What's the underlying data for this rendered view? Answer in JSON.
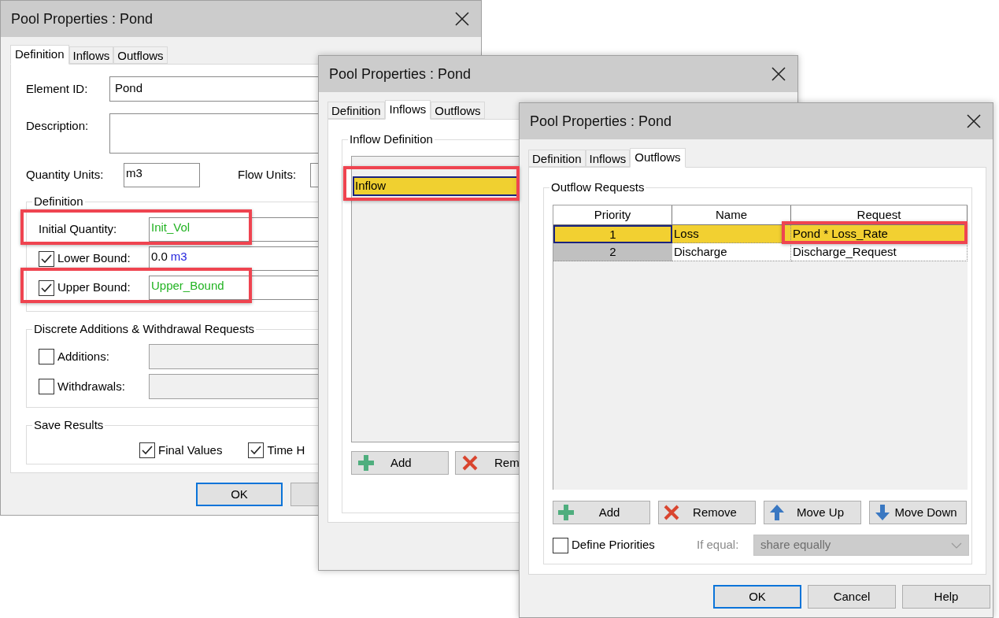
{
  "definition_dialog": {
    "title": "Pool Properties : Pond",
    "tabs": [
      {
        "label": "Definition",
        "selected": true
      },
      {
        "label": "Inflows",
        "selected": false
      },
      {
        "label": "Outflows",
        "selected": false
      }
    ],
    "element_id": {
      "label": "Element ID:",
      "value": "Pond"
    },
    "description": {
      "label": "Description:"
    },
    "quantity_units": {
      "label": "Quantity Units:",
      "value": "m3"
    },
    "flow_units": {
      "label": "Flow Units:"
    },
    "definition": {
      "title": "Definition",
      "initial_quantity": {
        "label": "Initial Quantity:",
        "kind": "expression",
        "value": "Init_Vol",
        "highlighted": true
      },
      "bounds": [
        {
          "label": "Lower Bound:",
          "checked": true,
          "kind": "number",
          "value": "0.0",
          "unit": "m3",
          "highlighted": false
        },
        {
          "label": "Upper Bound:",
          "checked": true,
          "kind": "expression",
          "value": "Upper_Bound",
          "highlighted": true
        }
      ]
    },
    "discrete": {
      "title": "Discrete Additions & Withdrawal Requests",
      "rows": [
        {
          "label": "Additions:",
          "checked": false
        },
        {
          "label": "Withdrawals:",
          "checked": false
        }
      ]
    },
    "save_results": {
      "title": "Save Results",
      "options": [
        {
          "label": "Final Values",
          "checked": true
        },
        {
          "label": "Time H",
          "checked": true
        }
      ]
    },
    "buttons": [
      {
        "label": "OK",
        "default": true
      }
    ]
  },
  "inflows_dialog": {
    "title": "Pool Properties : Pond",
    "tabs": [
      {
        "label": "Definition",
        "selected": false
      },
      {
        "label": "Inflows",
        "selected": true
      },
      {
        "label": "Outflows",
        "selected": false
      }
    ],
    "group_title": "Inflow Definition",
    "items": [
      {
        "label": "Inflow",
        "selected": true,
        "highlighted": true
      }
    ],
    "buttons": [
      {
        "label": "Add",
        "kind": "plus"
      },
      {
        "label": "Rem",
        "kind": "cross"
      }
    ]
  },
  "outflows_dialog": {
    "title": "Pool Properties : Pond",
    "tabs": [
      {
        "label": "Definition",
        "selected": false
      },
      {
        "label": "Inflows",
        "selected": false
      },
      {
        "label": "Outflows",
        "selected": true
      }
    ],
    "group_title": "Outflow Requests",
    "table": {
      "columns": [
        "Priority",
        "Name",
        "Request"
      ],
      "rows": [
        {
          "cells": [
            "1",
            "Loss",
            "Pond * Loss_Rate"
          ],
          "selected": true,
          "request_highlighted": true
        },
        {
          "cells": [
            "2",
            "Discharge",
            "Discharge_Request"
          ],
          "selected": false,
          "request_highlighted": false
        }
      ]
    },
    "buttons": [
      {
        "label": "Add",
        "kind": "plus"
      },
      {
        "label": "Remove",
        "kind": "cross"
      },
      {
        "label": "Move Up",
        "kind": "up"
      },
      {
        "label": "Move Down",
        "kind": "down"
      }
    ],
    "define_priorities": {
      "label": "Define Priorities",
      "checked": false
    },
    "if_equal": {
      "label": "If equal:",
      "value": "share equally",
      "disabled": true
    },
    "footer_buttons": [
      {
        "label": "OK",
        "default": true
      },
      {
        "label": "Cancel",
        "default": false
      },
      {
        "label": "Help",
        "default": false
      }
    ]
  }
}
